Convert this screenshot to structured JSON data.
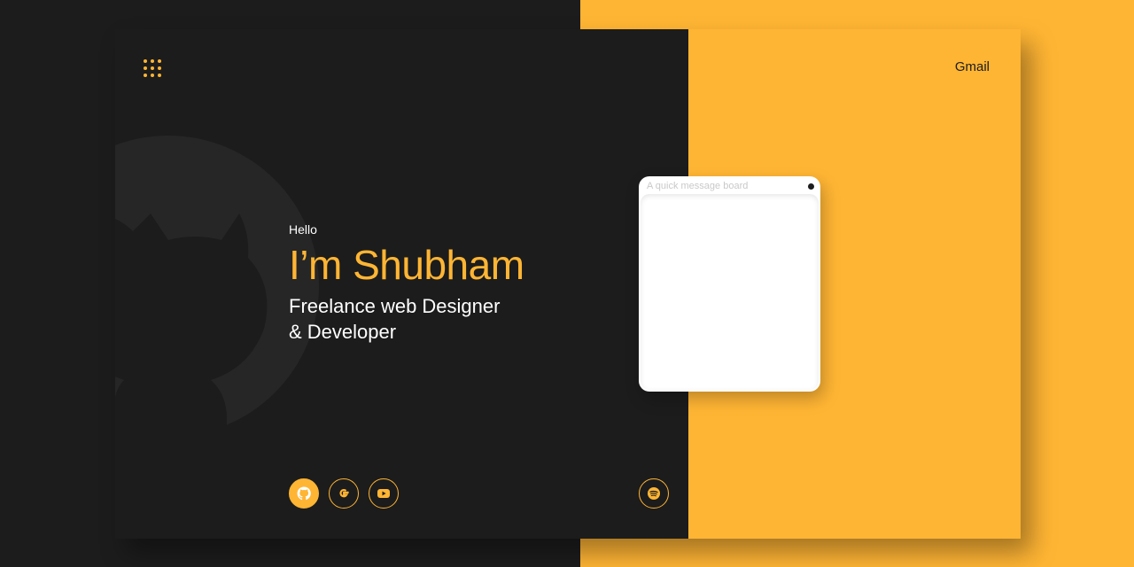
{
  "colors": {
    "accent": "#ffb534",
    "dark": "#1c1c1c",
    "board": "#ffffff"
  },
  "hero": {
    "greeting": "Hello",
    "name": "I’m Shubham",
    "role_line1": "Freelance web Designer",
    "role_line2": "& Developer"
  },
  "nav": {
    "menu_icon": "grid-dots-icon",
    "gmail_label": "Gmail"
  },
  "social": [
    {
      "icon": "github-icon",
      "active": true
    },
    {
      "icon": "google-icon",
      "active": false
    },
    {
      "icon": "youtube-icon",
      "active": false
    },
    {
      "icon": "spotify-icon",
      "active": false
    }
  ],
  "message_board": {
    "placeholder": "A quick message board"
  },
  "background_icon": "github-icon"
}
